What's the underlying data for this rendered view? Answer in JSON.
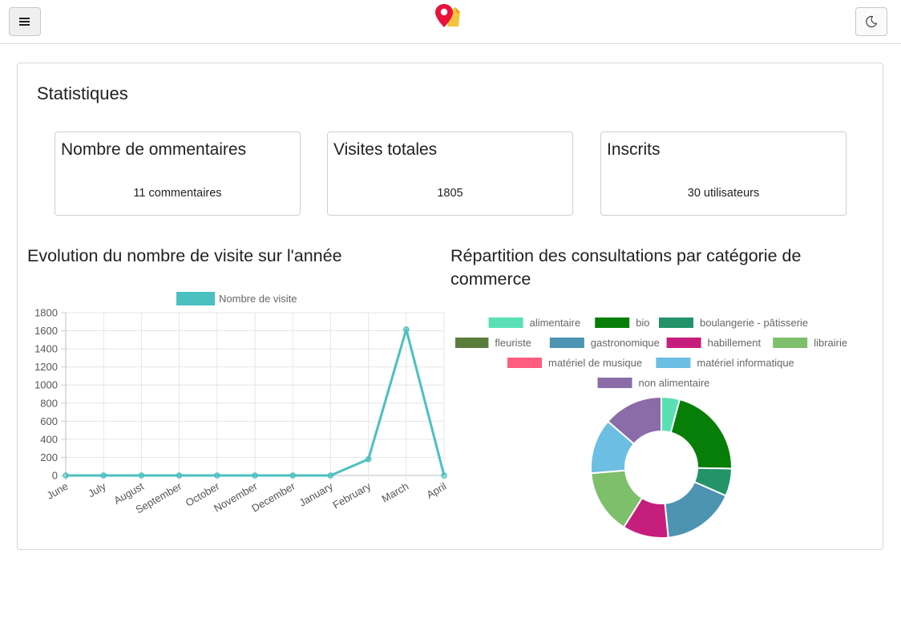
{
  "navbar": {
    "menu_icon": "hamburger-icon",
    "logo_icon": "map-pin-logo-icon",
    "theme_icon": "moon-icon"
  },
  "page_title": "Statistiques",
  "stats": [
    {
      "title": "Nombre de ommentaires",
      "value": "11 commentaires"
    },
    {
      "title": "Visites totales",
      "value": "1805"
    },
    {
      "title": "Inscrits",
      "value": "30 utilisateurs"
    }
  ],
  "line_section_title": "Evolution du nombre de visite sur l'année",
  "donut_section_title": "Répartition des consultations par catégorie de commerce",
  "colors": {
    "line": "#4bc0c0"
  },
  "chart_data": [
    {
      "type": "line",
      "series": [
        {
          "name": "Nombre de visite",
          "values": [
            0,
            0,
            0,
            0,
            0,
            0,
            0,
            0,
            180,
            1615,
            0
          ]
        }
      ],
      "categories": [
        "June",
        "July",
        "August",
        "September",
        "October",
        "November",
        "December",
        "January",
        "February",
        "March",
        "April"
      ],
      "yticks": [
        "0",
        "200",
        "400",
        "600",
        "800",
        "1000",
        "1200",
        "1400",
        "1600",
        "1800"
      ],
      "ylim": [
        0,
        1800
      ],
      "grid": true,
      "legend": "top",
      "title": "",
      "xlabel": "",
      "ylabel": ""
    },
    {
      "type": "pie",
      "legend": "top",
      "labels": [
        "alimentaire",
        "bio",
        "boulangerie - pâtisserie",
        "fleuriste",
        "gastronomique",
        "habillement",
        "librairie",
        "matériel de musique",
        "matériel informatique",
        "non alimentaire"
      ],
      "values": [
        4,
        20,
        6,
        0,
        16,
        10,
        14,
        0,
        12,
        13
      ],
      "colors": [
        "#59e0b4",
        "#077e07",
        "#23946a",
        "#5b7d3b",
        "#4d93b2",
        "#c61e7c",
        "#7dbf6a",
        "#fe5d7f",
        "#6cbee2",
        "#8a6ca8"
      ]
    }
  ]
}
